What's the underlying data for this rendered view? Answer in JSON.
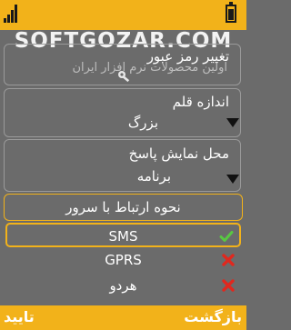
{
  "watermark": "SOFTGOZAR.COM",
  "settings": {
    "password": {
      "label": "تغییر رمز عبور",
      "subtext": "اولین محصولات نرم افزار ایران"
    },
    "font_size": {
      "label": "اندازه قلم",
      "value": "بزرگ"
    },
    "answer_display": {
      "label": "محل نمایش پاسخ",
      "value": "برنامه"
    }
  },
  "server_connection": {
    "title": "نحوه ارتباط با سرور",
    "options": [
      {
        "label": "SMS",
        "status_icon": "check-icon"
      },
      {
        "label": "GPRS",
        "status_icon": "cross-icon"
      },
      {
        "label": "هردو",
        "status_icon": "cross-icon"
      }
    ]
  },
  "softkeys": {
    "back": "بازگشت",
    "confirm": "تایید"
  },
  "colors": {
    "accent": "#f2b21a",
    "background": "#6b6b6b",
    "check": "#58c842",
    "cross": "#e0281e"
  }
}
